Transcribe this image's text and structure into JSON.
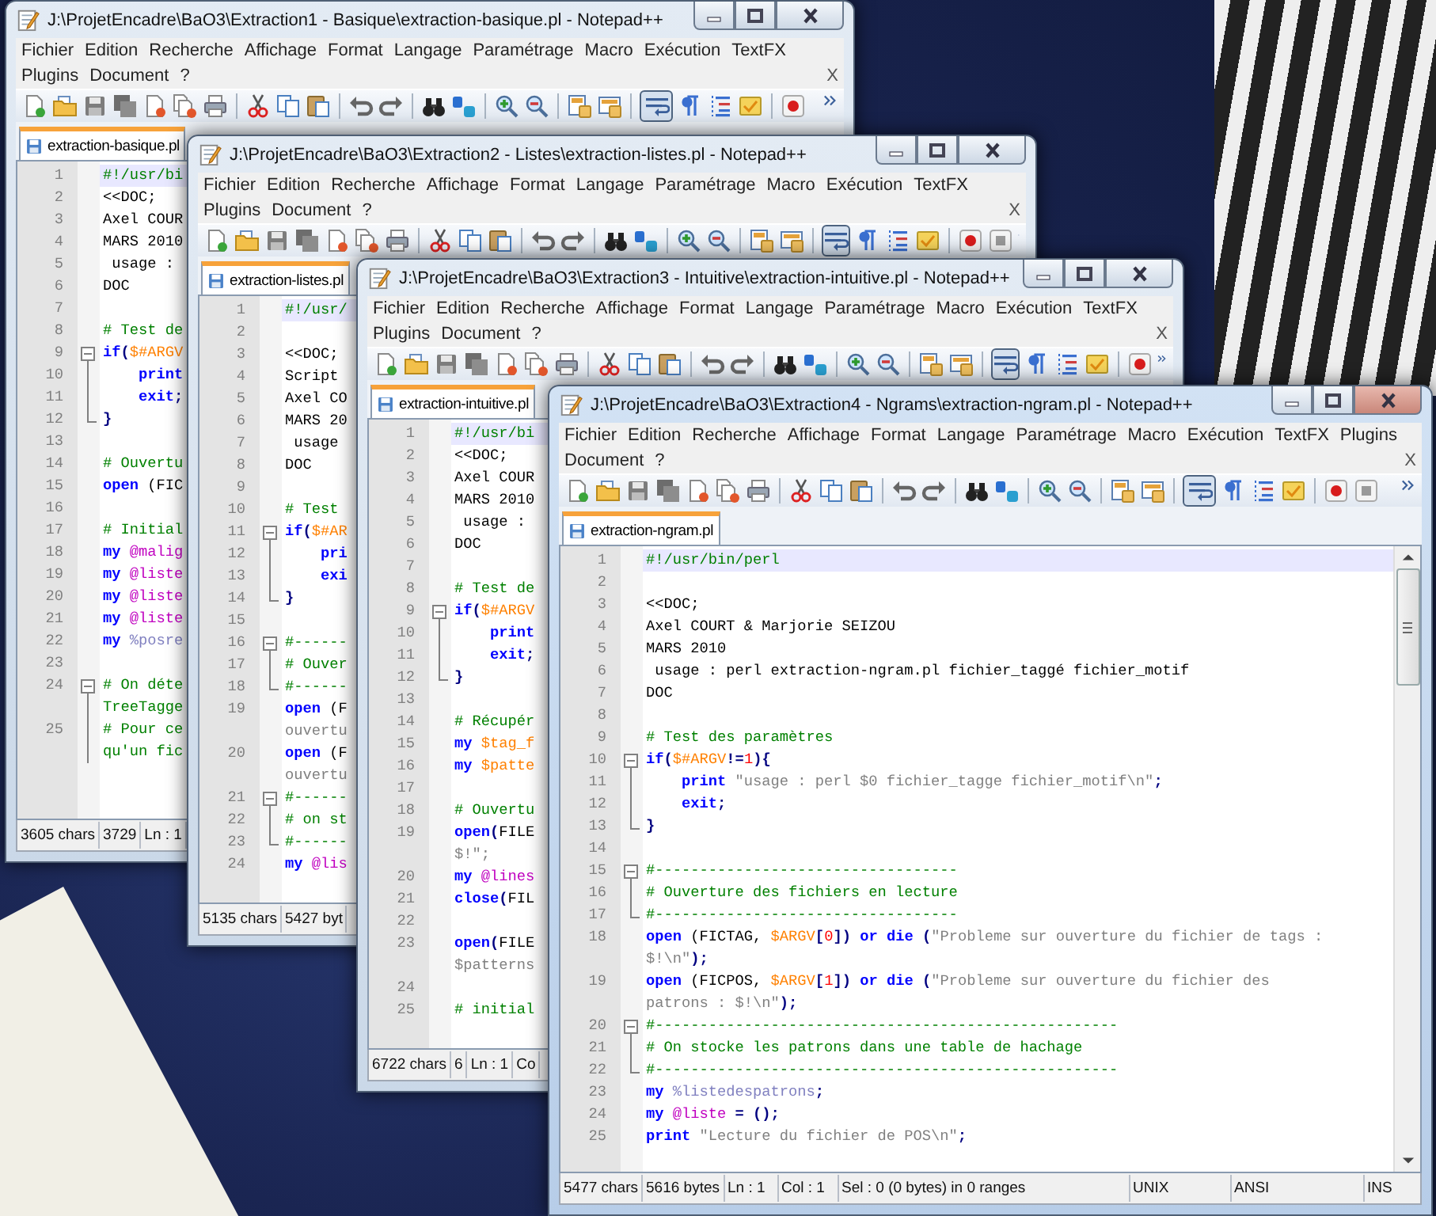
{
  "windows": [
    {
      "title": "J:\\ProjetEncadre\\BaO3\\Extraction1 - Basique\\extraction-basique.pl - Notepad++",
      "active": false,
      "word_wrap": true,
      "menu": [
        [
          "Fichier",
          "Edition",
          "Recherche",
          "Affichage",
          "Format",
          "Langage",
          "Paramétrage",
          "Macro",
          "Exécution",
          "TextFX"
        ],
        [
          "Plugins",
          "Document",
          "?"
        ]
      ],
      "menu_close": "X",
      "tabs": [
        {
          "label": "extraction-basique.pl",
          "selected": true
        }
      ],
      "lines": [
        {
          "number": "1",
          "kind": "plain",
          "current": true,
          "segments": [
            {
              "kind": "comment",
              "text": "#!/usr/bi"
            }
          ]
        },
        {
          "number": "2",
          "kind": "plain",
          "current": false,
          "segments": [
            {
              "kind": "plain",
              "text": "<<DOC;"
            }
          ]
        },
        {
          "number": "3",
          "kind": "plain",
          "current": false,
          "segments": [
            {
              "kind": "plain",
              "text": "Axel COUR"
            }
          ]
        },
        {
          "number": "4",
          "kind": "plain",
          "current": false,
          "segments": [
            {
              "kind": "plain",
              "text": "MARS 2010"
            }
          ]
        },
        {
          "number": "5",
          "kind": "plain",
          "current": false,
          "segments": [
            {
              "kind": "plain",
              "text": " usage :"
            }
          ]
        },
        {
          "number": "6",
          "kind": "plain",
          "current": false,
          "segments": [
            {
              "kind": "plain",
              "text": "DOC"
            }
          ]
        },
        {
          "number": "7",
          "kind": "plain",
          "current": false
        },
        {
          "number": "8",
          "kind": "plain",
          "current": false,
          "segments": [
            {
              "kind": "comment",
              "text": "# Test de"
            }
          ]
        },
        {
          "number": "9",
          "kind": "fold-start",
          "current": false,
          "segments": [
            {
              "kind": "keyword",
              "text": "if"
            },
            {
              "kind": "operator",
              "text": "("
            },
            {
              "kind": "scalar",
              "text": "$#ARGV"
            }
          ]
        },
        {
          "number": "10",
          "kind": "fold-body",
          "current": false,
          "segments": [
            {
              "kind": "keyword",
              "text": "    print"
            }
          ]
        },
        {
          "number": "11",
          "kind": "fold-body",
          "current": false,
          "segments": [
            {
              "kind": "keyword",
              "text": "    exit"
            },
            {
              "kind": "operator",
              "text": ";"
            }
          ]
        },
        {
          "number": "12",
          "kind": "fold-end",
          "current": false,
          "segments": [
            {
              "kind": "operator",
              "text": "}"
            }
          ]
        },
        {
          "number": "13",
          "kind": "plain",
          "current": false
        },
        {
          "number": "14",
          "kind": "plain",
          "current": false,
          "segments": [
            {
              "kind": "comment",
              "text": "# Ouvertu"
            }
          ]
        },
        {
          "number": "15",
          "kind": "plain",
          "current": false,
          "segments": [
            {
              "kind": "keyword",
              "text": "open"
            },
            {
              "kind": "plain",
              "text": " (FIC"
            }
          ]
        },
        {
          "number": "16",
          "kind": "plain",
          "current": false
        },
        {
          "number": "17",
          "kind": "plain",
          "current": false,
          "segments": [
            {
              "kind": "comment",
              "text": "# Initial"
            }
          ]
        },
        {
          "number": "18",
          "kind": "plain",
          "current": false,
          "segments": [
            {
              "kind": "keyword",
              "text": "my "
            },
            {
              "kind": "array",
              "text": "@malig"
            }
          ]
        },
        {
          "number": "19",
          "kind": "plain",
          "current": false,
          "segments": [
            {
              "kind": "keyword",
              "text": "my "
            },
            {
              "kind": "array",
              "text": "@liste"
            }
          ]
        },
        {
          "number": "20",
          "kind": "plain",
          "current": false,
          "segments": [
            {
              "kind": "keyword",
              "text": "my "
            },
            {
              "kind": "array",
              "text": "@liste"
            }
          ]
        },
        {
          "number": "21",
          "kind": "plain",
          "current": false,
          "segments": [
            {
              "kind": "keyword",
              "text": "my "
            },
            {
              "kind": "array",
              "text": "@liste"
            }
          ]
        },
        {
          "number": "22",
          "kind": "plain",
          "current": false,
          "segments": [
            {
              "kind": "keyword",
              "text": "my "
            },
            {
              "kind": "hash",
              "text": "%posre"
            }
          ]
        },
        {
          "number": "23",
          "kind": "plain",
          "current": false
        },
        {
          "number": "24",
          "kind": "fold-start",
          "current": false,
          "segments": [
            {
              "kind": "comment",
              "text": "# On déte"
            }
          ],
          "wrap": [
            {
              "kind": "comment",
              "text": "TreeTagge"
            }
          ]
        },
        {
          "number": "25",
          "kind": "fold-body",
          "current": false,
          "segments": [
            {
              "kind": "comment",
              "text": "# Pour ce"
            }
          ],
          "wrap": [
            {
              "kind": "comment",
              "text": "qu'un fic"
            }
          ]
        }
      ],
      "status": [
        "3605 chars",
        "3729",
        "Ln : 1"
      ]
    },
    {
      "title": "J:\\ProjetEncadre\\BaO3\\Extraction2 - Listes\\extraction-listes.pl - Notepad++",
      "active": false,
      "word_wrap": true,
      "menu": [
        [
          "Fichier",
          "Edition",
          "Recherche",
          "Affichage",
          "Format",
          "Langage",
          "Paramétrage",
          "Macro",
          "Exécution",
          "TextFX"
        ],
        [
          "Plugins",
          "Document",
          "?"
        ]
      ],
      "menu_close": "X",
      "tabs": [
        {
          "label": "extraction-listes.pl",
          "selected": true
        }
      ],
      "lines": [
        {
          "number": "1",
          "kind": "plain",
          "current": true,
          "segments": [
            {
              "kind": "comment",
              "text": "#!/usr/"
            }
          ]
        },
        {
          "number": "2",
          "kind": "plain",
          "current": false
        },
        {
          "number": "3",
          "kind": "plain",
          "current": false,
          "segments": [
            {
              "kind": "plain",
              "text": "<<DOC;"
            }
          ]
        },
        {
          "number": "4",
          "kind": "plain",
          "current": false,
          "segments": [
            {
              "kind": "plain",
              "text": "Script"
            }
          ]
        },
        {
          "number": "5",
          "kind": "plain",
          "current": false,
          "segments": [
            {
              "kind": "plain",
              "text": "Axel CO"
            }
          ]
        },
        {
          "number": "6",
          "kind": "plain",
          "current": false,
          "segments": [
            {
              "kind": "plain",
              "text": "MARS 20"
            }
          ]
        },
        {
          "number": "7",
          "kind": "plain",
          "current": false,
          "segments": [
            {
              "kind": "plain",
              "text": " usage"
            }
          ]
        },
        {
          "number": "8",
          "kind": "plain",
          "current": false,
          "segments": [
            {
              "kind": "plain",
              "text": "DOC"
            }
          ]
        },
        {
          "number": "9",
          "kind": "plain",
          "current": false
        },
        {
          "number": "10",
          "kind": "plain",
          "current": false,
          "segments": [
            {
              "kind": "comment",
              "text": "# Test"
            }
          ]
        },
        {
          "number": "11",
          "kind": "fold-start",
          "current": false,
          "segments": [
            {
              "kind": "keyword",
              "text": "if"
            },
            {
              "kind": "operator",
              "text": "("
            },
            {
              "kind": "scalar",
              "text": "$#AR"
            }
          ]
        },
        {
          "number": "12",
          "kind": "fold-body",
          "current": false,
          "segments": [
            {
              "kind": "keyword",
              "text": "    pri"
            }
          ]
        },
        {
          "number": "13",
          "kind": "fold-body",
          "current": false,
          "segments": [
            {
              "kind": "keyword",
              "text": "    exi"
            }
          ]
        },
        {
          "number": "14",
          "kind": "fold-end",
          "current": false,
          "segments": [
            {
              "kind": "operator",
              "text": "}"
            }
          ]
        },
        {
          "number": "15",
          "kind": "plain",
          "current": false
        },
        {
          "number": "16",
          "kind": "fold-start",
          "current": false,
          "segments": [
            {
              "kind": "comment",
              "text": "#------"
            }
          ]
        },
        {
          "number": "17",
          "kind": "fold-body",
          "current": false,
          "segments": [
            {
              "kind": "comment",
              "text": "# Ouver"
            }
          ]
        },
        {
          "number": "18",
          "kind": "fold-end",
          "current": false,
          "segments": [
            {
              "kind": "comment",
              "text": "#------"
            }
          ]
        },
        {
          "number": "19",
          "kind": "plain",
          "current": false,
          "segments": [
            {
              "kind": "keyword",
              "text": "open"
            },
            {
              "kind": "plain",
              "text": " (F"
            }
          ],
          "wrap": [
            {
              "kind": "string",
              "text": "ouvertu"
            }
          ]
        },
        {
          "number": "20",
          "kind": "plain",
          "current": false,
          "segments": [
            {
              "kind": "keyword",
              "text": "open"
            },
            {
              "kind": "plain",
              "text": " (F"
            }
          ],
          "wrap": [
            {
              "kind": "string",
              "text": "ouvertu"
            }
          ]
        },
        {
          "number": "21",
          "kind": "fold-start",
          "current": false,
          "segments": [
            {
              "kind": "comment",
              "text": "#------"
            }
          ]
        },
        {
          "number": "22",
          "kind": "fold-body",
          "current": false,
          "segments": [
            {
              "kind": "comment",
              "text": "# on st"
            }
          ]
        },
        {
          "number": "23",
          "kind": "fold-end",
          "current": false,
          "segments": [
            {
              "kind": "comment",
              "text": "#------"
            }
          ]
        },
        {
          "number": "24",
          "kind": "plain",
          "current": false,
          "segments": [
            {
              "kind": "keyword",
              "text": "my "
            },
            {
              "kind": "array",
              "text": "@lis"
            }
          ]
        }
      ],
      "status": [
        "5135 chars",
        "5427 byt"
      ]
    },
    {
      "title": "J:\\ProjetEncadre\\BaO3\\Extraction3 - Intuitive\\extraction-intuitive.pl - Notepad++",
      "active": false,
      "word_wrap": true,
      "menu": [
        [
          "Fichier",
          "Edition",
          "Recherche",
          "Affichage",
          "Format",
          "Langage",
          "Paramétrage",
          "Macro",
          "Exécution",
          "TextFX"
        ],
        [
          "Plugins",
          "Document",
          "?"
        ]
      ],
      "menu_close": "X",
      "tabs": [
        {
          "label": "extraction-intuitive.pl",
          "selected": true
        }
      ],
      "lines": [
        {
          "number": "1",
          "kind": "plain",
          "current": true,
          "segments": [
            {
              "kind": "comment",
              "text": "#!/usr/bi"
            }
          ]
        },
        {
          "number": "2",
          "kind": "plain",
          "current": false,
          "segments": [
            {
              "kind": "plain",
              "text": "<<DOC;"
            }
          ]
        },
        {
          "number": "3",
          "kind": "plain",
          "current": false,
          "segments": [
            {
              "kind": "plain",
              "text": "Axel COUR"
            }
          ]
        },
        {
          "number": "4",
          "kind": "plain",
          "current": false,
          "segments": [
            {
              "kind": "plain",
              "text": "MARS 2010"
            }
          ]
        },
        {
          "number": "5",
          "kind": "plain",
          "current": false,
          "segments": [
            {
              "kind": "plain",
              "text": " usage :"
            }
          ]
        },
        {
          "number": "6",
          "kind": "plain",
          "current": false,
          "segments": [
            {
              "kind": "plain",
              "text": "DOC"
            }
          ]
        },
        {
          "number": "7",
          "kind": "plain",
          "current": false
        },
        {
          "number": "8",
          "kind": "plain",
          "current": false,
          "segments": [
            {
              "kind": "comment",
              "text": "# Test de"
            }
          ]
        },
        {
          "number": "9",
          "kind": "fold-start",
          "current": false,
          "segments": [
            {
              "kind": "keyword",
              "text": "if"
            },
            {
              "kind": "operator",
              "text": "("
            },
            {
              "kind": "scalar",
              "text": "$#ARGV"
            }
          ]
        },
        {
          "number": "10",
          "kind": "fold-body",
          "current": false,
          "segments": [
            {
              "kind": "keyword",
              "text": "    print"
            }
          ]
        },
        {
          "number": "11",
          "kind": "fold-body",
          "current": false,
          "segments": [
            {
              "kind": "keyword",
              "text": "    exit"
            },
            {
              "kind": "operator",
              "text": ";"
            }
          ]
        },
        {
          "number": "12",
          "kind": "fold-end",
          "current": false,
          "segments": [
            {
              "kind": "operator",
              "text": "}"
            }
          ]
        },
        {
          "number": "13",
          "kind": "plain",
          "current": false
        },
        {
          "number": "14",
          "kind": "plain",
          "current": false,
          "segments": [
            {
              "kind": "comment",
              "text": "# Récupér"
            }
          ]
        },
        {
          "number": "15",
          "kind": "plain",
          "current": false,
          "segments": [
            {
              "kind": "keyword",
              "text": "my "
            },
            {
              "kind": "scalar",
              "text": "$tag_f"
            }
          ]
        },
        {
          "number": "16",
          "kind": "plain",
          "current": false,
          "segments": [
            {
              "kind": "keyword",
              "text": "my "
            },
            {
              "kind": "scalar",
              "text": "$patte"
            }
          ]
        },
        {
          "number": "17",
          "kind": "plain",
          "current": false
        },
        {
          "number": "18",
          "kind": "plain",
          "current": false,
          "segments": [
            {
              "kind": "comment",
              "text": "# Ouvertu"
            }
          ]
        },
        {
          "number": "19",
          "kind": "plain",
          "current": false,
          "segments": [
            {
              "kind": "keyword",
              "text": "open"
            },
            {
              "kind": "operator",
              "text": "("
            },
            {
              "kind": "plain",
              "text": "FILE"
            }
          ],
          "wrap": [
            {
              "kind": "string",
              "text": "$!\";"
            }
          ]
        },
        {
          "number": "20",
          "kind": "plain",
          "current": false,
          "segments": [
            {
              "kind": "keyword",
              "text": "my "
            },
            {
              "kind": "array",
              "text": "@lines"
            }
          ]
        },
        {
          "number": "21",
          "kind": "plain",
          "current": false,
          "segments": [
            {
              "kind": "keyword",
              "text": "close"
            },
            {
              "kind": "operator",
              "text": "("
            },
            {
              "kind": "plain",
              "text": "FIL"
            }
          ]
        },
        {
          "number": "22",
          "kind": "plain",
          "current": false
        },
        {
          "number": "23",
          "kind": "plain",
          "current": false,
          "segments": [
            {
              "kind": "keyword",
              "text": "open"
            },
            {
              "kind": "operator",
              "text": "("
            },
            {
              "kind": "plain",
              "text": "FILE"
            }
          ],
          "wrap": [
            {
              "kind": "string",
              "text": "$patterns"
            }
          ]
        },
        {
          "number": "24",
          "kind": "plain",
          "current": false
        },
        {
          "number": "25",
          "kind": "plain",
          "current": false,
          "segments": [
            {
              "kind": "comment",
              "text": "# initial"
            }
          ]
        }
      ],
      "status": [
        "6722 chars",
        "6",
        "Ln : 1",
        "Co"
      ]
    },
    {
      "title": "J:\\ProjetEncadre\\BaO3\\Extraction4 - Ngrams\\extraction-ngram.pl - Notepad++",
      "active": true,
      "word_wrap": true,
      "vertical_scrollbar": true,
      "menu": [
        [
          "Fichier",
          "Edition",
          "Recherche",
          "Affichage",
          "Format",
          "Langage",
          "Paramétrage",
          "Macro",
          "Exécution",
          "TextFX",
          "Plugins"
        ],
        [
          "Document",
          "?"
        ]
      ],
      "menu_close": "X",
      "tabs": [
        {
          "label": "extraction-ngram.pl",
          "selected": true
        }
      ],
      "lines": [
        {
          "number": "1",
          "kind": "plain",
          "current": true,
          "segments": [
            {
              "kind": "comment",
              "text": "#!/usr/bin/perl"
            }
          ]
        },
        {
          "number": "2",
          "kind": "plain",
          "current": false
        },
        {
          "number": "3",
          "kind": "plain",
          "current": false,
          "segments": [
            {
              "kind": "plain",
              "text": "<<DOC;"
            }
          ]
        },
        {
          "number": "4",
          "kind": "plain",
          "current": false,
          "segments": [
            {
              "kind": "plain",
              "text": "Axel COURT & Marjorie SEIZOU"
            }
          ]
        },
        {
          "number": "5",
          "kind": "plain",
          "current": false,
          "segments": [
            {
              "kind": "plain",
              "text": "MARS 2010"
            }
          ]
        },
        {
          "number": "6",
          "kind": "plain",
          "current": false,
          "segments": [
            {
              "kind": "plain",
              "text": " usage : perl extraction-ngram.pl fichier_taggé fichier_motif"
            }
          ]
        },
        {
          "number": "7",
          "kind": "plain",
          "current": false,
          "segments": [
            {
              "kind": "plain",
              "text": "DOC"
            }
          ]
        },
        {
          "number": "8",
          "kind": "plain",
          "current": false
        },
        {
          "number": "9",
          "kind": "plain",
          "current": false,
          "segments": [
            {
              "kind": "comment",
              "text": "# Test des paramètres"
            }
          ]
        },
        {
          "number": "10",
          "kind": "fold-start",
          "current": false,
          "segments": [
            {
              "kind": "keyword",
              "text": "if"
            },
            {
              "kind": "operator",
              "text": "("
            },
            {
              "kind": "scalar",
              "text": "$#ARGV"
            },
            {
              "kind": "operator",
              "text": "!="
            },
            {
              "kind": "number",
              "text": "1"
            },
            {
              "kind": "operator",
              "text": "){"
            }
          ]
        },
        {
          "number": "11",
          "kind": "fold-body",
          "current": false,
          "segments": [
            {
              "kind": "keyword",
              "text": "    print "
            },
            {
              "kind": "string",
              "text": "\"usage : perl $0 fichier_tagge fichier_motif\\n\""
            },
            {
              "kind": "operator",
              "text": ";"
            }
          ]
        },
        {
          "number": "12",
          "kind": "fold-body",
          "current": false,
          "segments": [
            {
              "kind": "keyword",
              "text": "    exit"
            },
            {
              "kind": "operator",
              "text": ";"
            }
          ]
        },
        {
          "number": "13",
          "kind": "fold-end",
          "current": false,
          "segments": [
            {
              "kind": "operator",
              "text": "}"
            }
          ]
        },
        {
          "number": "14",
          "kind": "plain",
          "current": false
        },
        {
          "number": "15",
          "kind": "fold-start",
          "current": false,
          "segments": [
            {
              "kind": "comment",
              "text": "#----------------------------------"
            }
          ]
        },
        {
          "number": "16",
          "kind": "fold-body",
          "current": false,
          "segments": [
            {
              "kind": "comment",
              "text": "# Ouverture des fichiers en lecture"
            }
          ]
        },
        {
          "number": "17",
          "kind": "fold-end",
          "current": false,
          "segments": [
            {
              "kind": "comment",
              "text": "#----------------------------------"
            }
          ]
        },
        {
          "number": "18",
          "kind": "plain",
          "current": false,
          "segments": [
            {
              "kind": "keyword",
              "text": "open"
            },
            {
              "kind": "plain",
              "text": " (FICTAG, "
            },
            {
              "kind": "scalar",
              "text": "$ARGV"
            },
            {
              "kind": "operator",
              "text": "["
            },
            {
              "kind": "number",
              "text": "0"
            },
            {
              "kind": "operator",
              "text": "])"
            },
            {
              "kind": "keyword",
              "text": " or die "
            },
            {
              "kind": "operator",
              "text": "("
            },
            {
              "kind": "string",
              "text": "\"Probleme sur ouverture du fichier de tags :"
            }
          ],
          "wrap": [
            {
              "kind": "string",
              "text": "$!\\n\""
            },
            {
              "kind": "operator",
              "text": ");"
            }
          ]
        },
        {
          "number": "19",
          "kind": "plain",
          "current": false,
          "segments": [
            {
              "kind": "keyword",
              "text": "open"
            },
            {
              "kind": "plain",
              "text": " (FICPOS, "
            },
            {
              "kind": "scalar",
              "text": "$ARGV"
            },
            {
              "kind": "operator",
              "text": "["
            },
            {
              "kind": "number",
              "text": "1"
            },
            {
              "kind": "operator",
              "text": "])"
            },
            {
              "kind": "keyword",
              "text": " or die "
            },
            {
              "kind": "operator",
              "text": "("
            },
            {
              "kind": "string",
              "text": "\"Probleme sur ouverture du fichier des"
            }
          ],
          "wrap": [
            {
              "kind": "string",
              "text": "patrons : $!\\n\""
            },
            {
              "kind": "operator",
              "text": ");"
            }
          ]
        },
        {
          "number": "20",
          "kind": "fold-start",
          "current": false,
          "segments": [
            {
              "kind": "comment",
              "text": "#----------------------------------------------------"
            }
          ]
        },
        {
          "number": "21",
          "kind": "fold-body",
          "current": false,
          "segments": [
            {
              "kind": "comment",
              "text": "# On stocke les patrons dans une table de hachage"
            }
          ]
        },
        {
          "number": "22",
          "kind": "fold-end",
          "current": false,
          "segments": [
            {
              "kind": "comment",
              "text": "#----------------------------------------------------"
            }
          ]
        },
        {
          "number": "23",
          "kind": "plain",
          "current": false,
          "segments": [
            {
              "kind": "keyword",
              "text": "my "
            },
            {
              "kind": "hash",
              "text": "%listedespatrons"
            },
            {
              "kind": "operator",
              "text": ";"
            }
          ]
        },
        {
          "number": "24",
          "kind": "plain",
          "current": false,
          "segments": [
            {
              "kind": "keyword",
              "text": "my "
            },
            {
              "kind": "array",
              "text": "@liste"
            },
            {
              "kind": "operator",
              "text": " = ();"
            }
          ]
        },
        {
          "number": "25",
          "kind": "plain",
          "current": false,
          "segments": [
            {
              "kind": "keyword",
              "text": "print "
            },
            {
              "kind": "string",
              "text": "\"Lecture du fichier de POS\\n\""
            },
            {
              "kind": "operator",
              "text": ";"
            }
          ]
        }
      ],
      "status": [
        "5477 chars",
        "5616 bytes",
        "Ln : 1",
        "Col : 1",
        "Sel : 0 (0 bytes) in 0 ranges",
        "UNIX",
        "ANSI",
        "INS"
      ]
    }
  ]
}
